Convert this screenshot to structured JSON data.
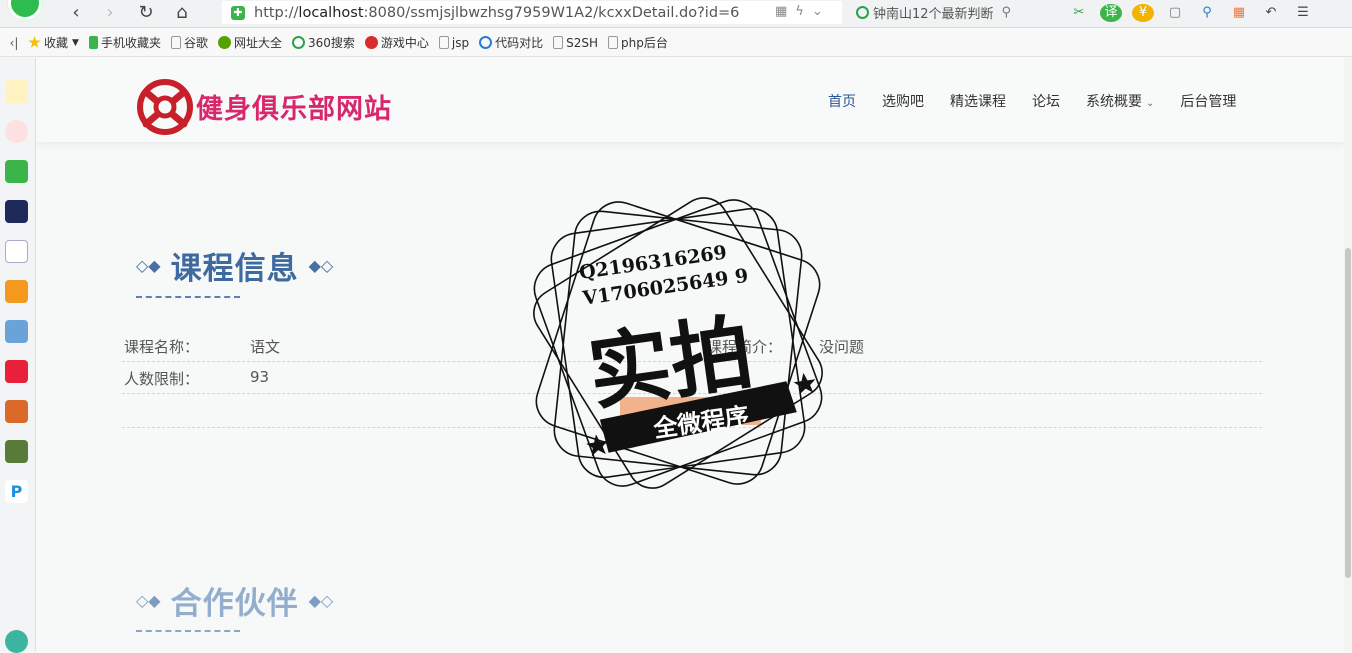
{
  "browser": {
    "url_prefix": "http://",
    "url_host": "localhost",
    "url_rest": ":8080/ssmjsjlbwzhsg7959W1A2/kcxxDetail.do?id=6",
    "search_text": "钟南山12个最新判断",
    "nav": {
      "back": "‹",
      "forward": "›",
      "reload": "↻",
      "home": "⌂"
    },
    "bookmarks": [
      {
        "label": "收藏",
        "icon": "star-icon",
        "color": "#f2c200"
      },
      {
        "label": "手机收藏夹",
        "icon": "phone-icon",
        "color": "#3bb54a"
      },
      {
        "label": "谷歌",
        "icon": "page-icon",
        "color": "#999999"
      },
      {
        "label": "网址大全",
        "icon": "globe-icon",
        "color": "#56a000"
      },
      {
        "label": "360搜索",
        "icon": "search-360-icon",
        "color": "#2aa34a"
      },
      {
        "label": "游戏中心",
        "icon": "game-icon",
        "color": "#d92b2b"
      },
      {
        "label": "jsp",
        "icon": "page-icon",
        "color": "#999999"
      },
      {
        "label": "代码对比",
        "icon": "compare-icon",
        "color": "#2a7ad4"
      },
      {
        "label": "S2SH",
        "icon": "page-icon",
        "color": "#999999"
      },
      {
        "label": "php后台",
        "icon": "page-icon",
        "color": "#999999"
      }
    ],
    "bookmarks_toggle": "‹|"
  },
  "site": {
    "logo_text": "健身俱乐部网站",
    "nav": [
      {
        "label": "首页",
        "active": true
      },
      {
        "label": "选购吧"
      },
      {
        "label": "精选课程"
      },
      {
        "label": "论坛"
      },
      {
        "label": "系统概要",
        "dropdown": true
      },
      {
        "label": "后台管理"
      }
    ]
  },
  "course_section": {
    "title": "课程信息",
    "fields": [
      {
        "label": "课程名称：",
        "value": "语文"
      },
      {
        "label": "人数限制：",
        "value": "93"
      }
    ],
    "field_right": {
      "label": "课程简介：",
      "value": "没问题"
    }
  },
  "partner_section": {
    "title": "合作伙伴"
  },
  "watermark": {
    "line1": "Q2196316269",
    "line2": "V1706025649 9",
    "big": "实拍",
    "ribbon": "全微程序"
  },
  "colors": {
    "brand": "#d8286d",
    "accent_blue": "#3e6aa0",
    "nav_active": "#2e5593"
  }
}
